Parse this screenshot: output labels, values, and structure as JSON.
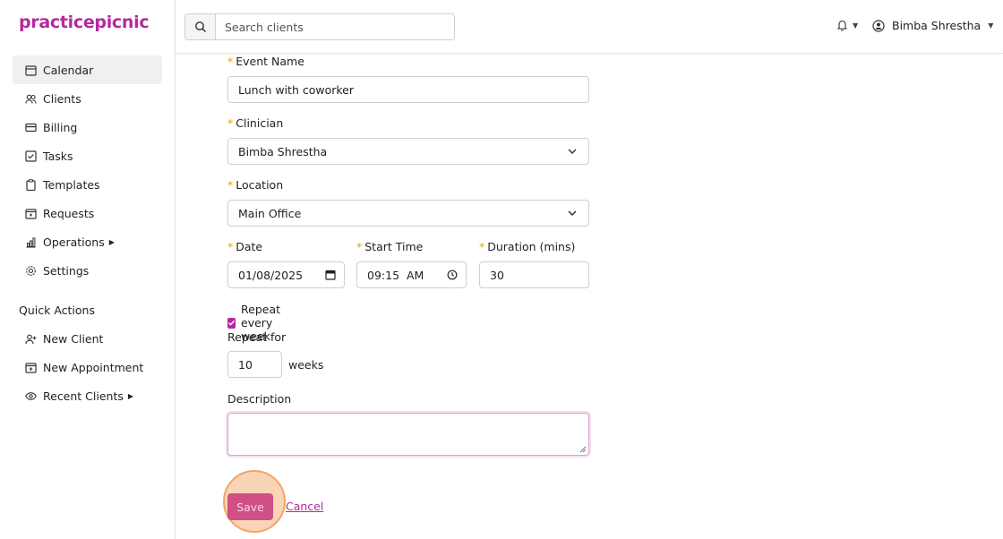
{
  "app": {
    "logo": "practicepicnic",
    "accent": "#b5299e"
  },
  "sidebar": {
    "items": [
      {
        "label": "Calendar",
        "icon": "calendar-icon",
        "active": true
      },
      {
        "label": "Clients",
        "icon": "users-icon"
      },
      {
        "label": "Billing",
        "icon": "credit-card-icon"
      },
      {
        "label": "Tasks",
        "icon": "checkbox-icon"
      },
      {
        "label": "Templates",
        "icon": "clipboard-icon"
      },
      {
        "label": "Requests",
        "icon": "inbox-icon"
      },
      {
        "label": "Operations",
        "icon": "bar-chart-icon",
        "expandable": true
      },
      {
        "label": "Settings",
        "icon": "gear-icon"
      }
    ],
    "quick_actions_title": "Quick Actions",
    "quick_actions": [
      {
        "label": "New Client",
        "icon": "user-plus-icon"
      },
      {
        "label": "New Appointment",
        "icon": "calendar-plus-icon"
      },
      {
        "label": "Recent Clients",
        "icon": "eye-icon",
        "expandable": true
      }
    ]
  },
  "header": {
    "search_placeholder": "Search clients",
    "user_name": "Bimba Shrestha"
  },
  "form": {
    "event_name_label": "Event Name",
    "event_name_value": "Lunch with coworker",
    "clinician_label": "Clinician",
    "clinician_value": "Bimba Shrestha",
    "location_label": "Location",
    "location_value": "Main Office",
    "date_label": "Date",
    "date_value": "01/08/2025",
    "start_time_label": "Start Time",
    "start_time_value": "09:15  AM",
    "duration_label": "Duration (mins)",
    "duration_value": "30",
    "repeat_checkbox_label": "Repeat every week",
    "repeat_checked": true,
    "repeat_for_label": "Repeat for",
    "repeat_for_value": "10",
    "repeat_unit": "weeks",
    "description_label": "Description",
    "description_value": "",
    "required_marker": "*",
    "save_label": "Save",
    "cancel_label": "Cancel"
  }
}
